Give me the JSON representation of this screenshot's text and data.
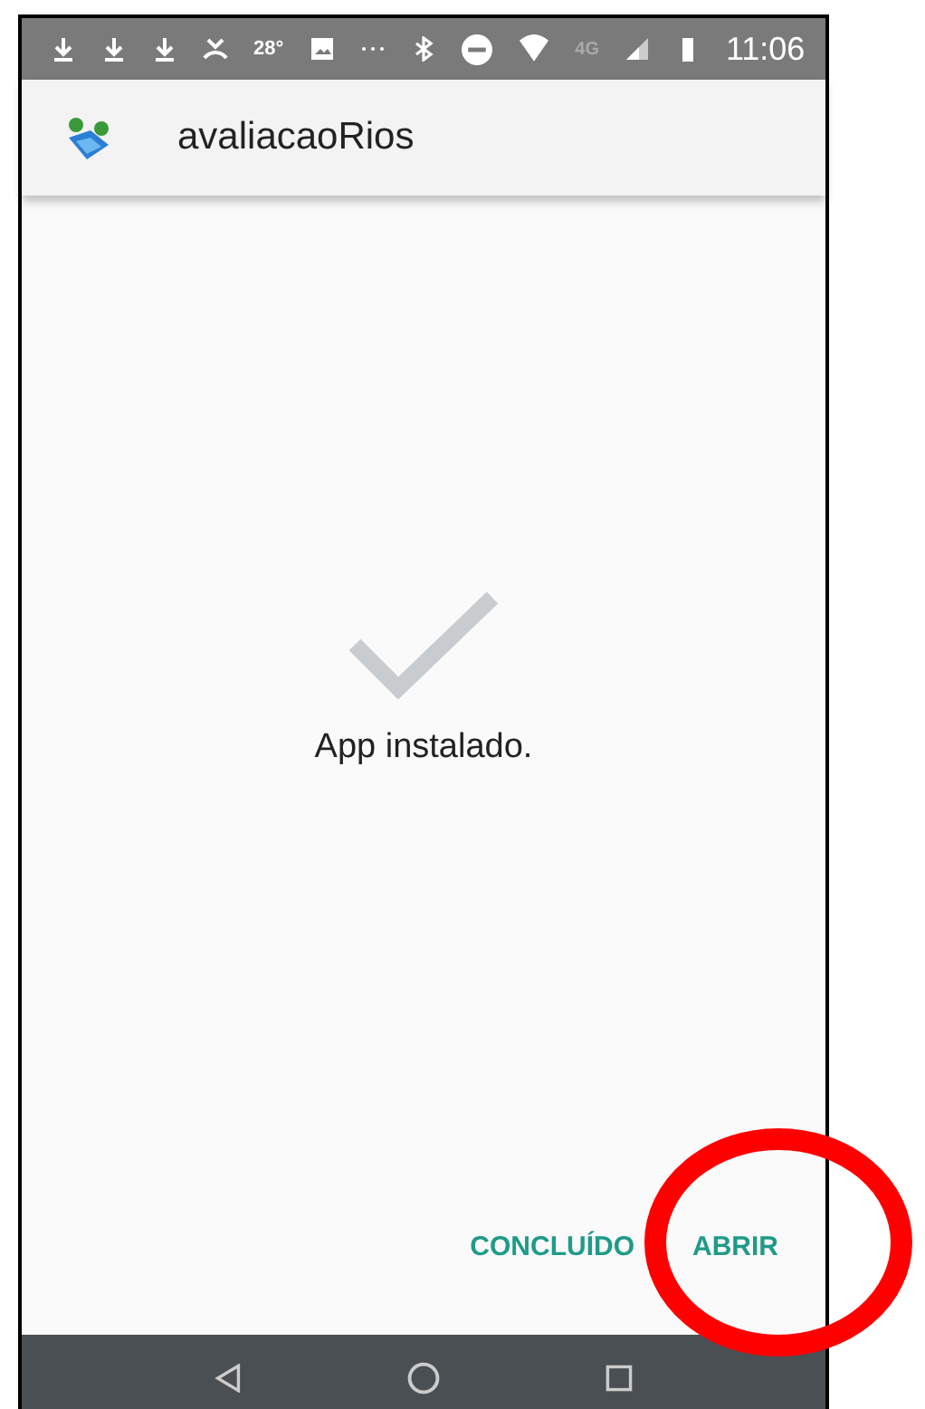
{
  "status_bar": {
    "temperature": "28°",
    "network": "4G",
    "time": "11:06"
  },
  "app_bar": {
    "title": "avaliacaoRios"
  },
  "message": "App instalado.",
  "buttons": [
    {
      "label": "CONCLUÍDO",
      "highlighted": false
    },
    {
      "label": "ABRIR",
      "highlighted": true
    }
  ]
}
